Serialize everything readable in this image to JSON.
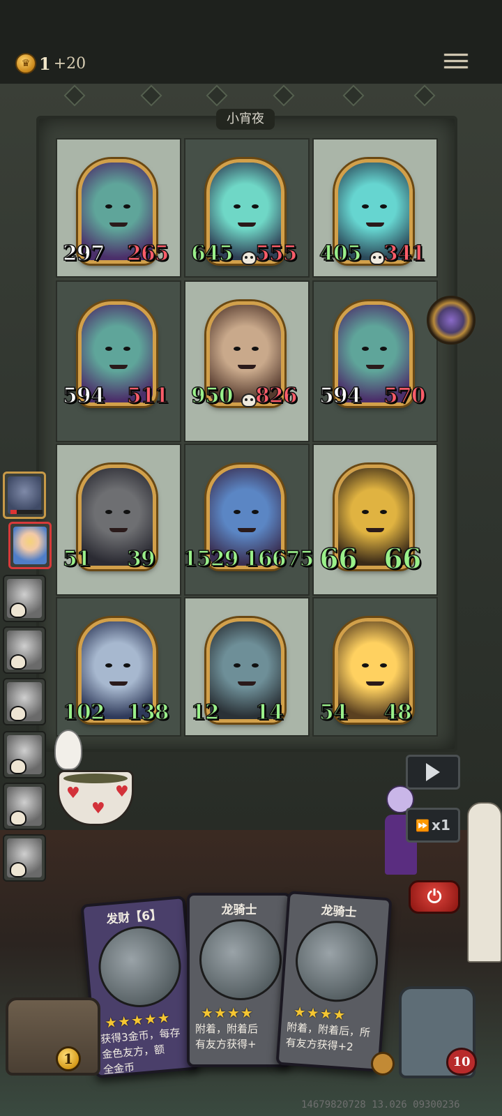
{
  "header": {
    "coin_icon": "crown-coin-icon",
    "coin_count": "1",
    "coin_income": "+20",
    "menu_icon": "hamburger-menu-icon"
  },
  "board": {
    "title": "小宵夜",
    "cells": [
      {
        "atk": "297",
        "hp": "265",
        "atk_color": "white",
        "hp_color": "red",
        "skull": false,
        "portrait": "ghost-beast",
        "tone": "light"
      },
      {
        "atk": "645",
        "hp": "555",
        "atk_color": "green",
        "hp_color": "red",
        "skull": true,
        "portrait": "phantom-spirit",
        "tone": "dark"
      },
      {
        "atk": "405",
        "hp": "341",
        "atk_color": "green",
        "hp_color": "red",
        "skull": true,
        "portrait": "water-spirit",
        "tone": "light"
      },
      {
        "atk": "594",
        "hp": "511",
        "atk_color": "white",
        "hp_color": "red",
        "skull": false,
        "portrait": "ghost-beast",
        "tone": "dark"
      },
      {
        "atk": "950",
        "hp": "826",
        "atk_color": "green",
        "hp_color": "red",
        "skull": true,
        "portrait": "old-woman",
        "tone": "light"
      },
      {
        "atk": "594",
        "hp": "570",
        "atk_color": "white",
        "hp_color": "red",
        "skull": false,
        "portrait": "ghost-beast",
        "tone": "dark"
      },
      {
        "atk": "51",
        "hp": "39",
        "atk_color": "green",
        "hp_color": "green",
        "skull": false,
        "portrait": "dark-dragon",
        "tone": "light"
      },
      {
        "atk": "1529",
        "hp": "16675",
        "atk_color": "green",
        "hp_color": "green",
        "skull": false,
        "portrait": "blue-dragon",
        "tone": "dark"
      },
      {
        "atk": "66",
        "hp": "66",
        "atk_color": "green",
        "hp_color": "green",
        "skull": false,
        "portrait": "golden-dragon-lord",
        "tone": "light",
        "big": true
      },
      {
        "atk": "102",
        "hp": "138",
        "atk_color": "green",
        "hp_color": "green",
        "skull": false,
        "portrait": "dragon-knight",
        "tone": "dark"
      },
      {
        "atk": "12",
        "hp": "14",
        "atk_color": "green",
        "hp_color": "green",
        "skull": false,
        "portrait": "horned-demon",
        "tone": "light"
      },
      {
        "atk": "54",
        "hp": "48",
        "atk_color": "green",
        "hp_color": "green",
        "skull": false,
        "portrait": "glowing-orb",
        "tone": "dark"
      }
    ]
  },
  "roster": {
    "slots": [
      {
        "name": "gargoyle",
        "state": "alive",
        "hp": 0.2
      },
      {
        "name": "alice",
        "state": "active"
      },
      {
        "name": "mouse",
        "state": "dead"
      },
      {
        "name": "hooded-figure",
        "state": "dead"
      },
      {
        "name": "cat-creature",
        "state": "dead"
      },
      {
        "name": "raccoon",
        "state": "dead"
      },
      {
        "name": "white-haired-woman",
        "state": "dead"
      },
      {
        "name": "blonde-woman",
        "state": "dead"
      }
    ]
  },
  "controls": {
    "play_icon": "play-icon",
    "speed_label": "x1",
    "speed_icon": "fast-forward-icon",
    "power_icon": "power-icon"
  },
  "hand": [
    {
      "title": "发财【6】",
      "stars": "★★★★★",
      "desc1": "获得3金币，每存",
      "desc2": "金色友方，额",
      "desc3": "全金币",
      "theme": "purple"
    },
    {
      "title": "龙骑士",
      "stars": "★★★★",
      "desc1": "附着，附着后",
      "desc2": "有友方获得+",
      "desc3": "",
      "theme": "gray"
    },
    {
      "title": "龙骑士",
      "stars": "★★★★",
      "desc1": "附着，附着后，所",
      "desc2": "有友方获得+2",
      "desc3": "",
      "theme": "gray"
    }
  ],
  "footer": {
    "chest_gold": "1",
    "hero_hp": "10",
    "build_id": "14679820728 13.026 09300236"
  },
  "colors": {
    "gold": "#d2a04a",
    "stat_green": "#9af08a",
    "stat_red": "#ff5d6a",
    "danger": "#d83a3a"
  }
}
